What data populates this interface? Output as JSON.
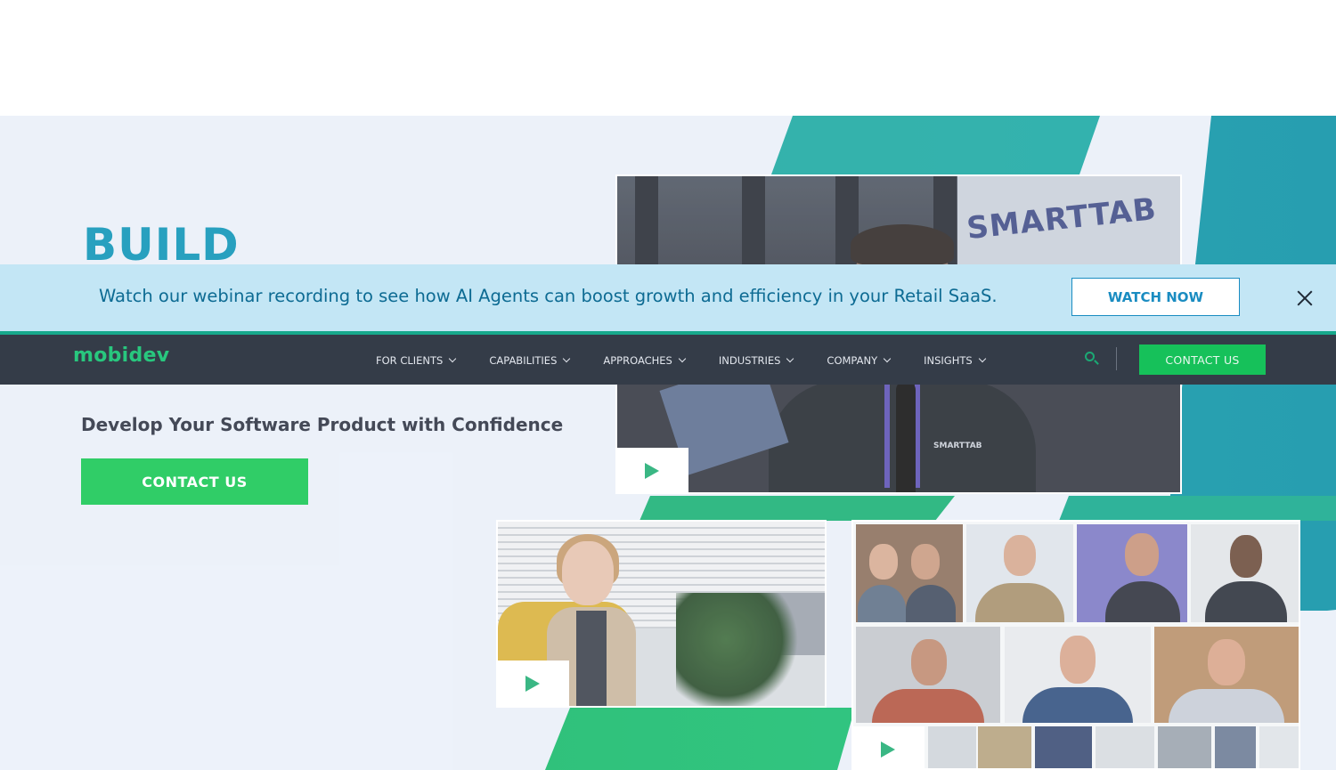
{
  "banner": {
    "text": "Watch our webinar recording to see how AI Agents can boost growth and efficiency in your Retail SaaS.",
    "button": "WATCH NOW"
  },
  "nav": {
    "logo": "mobidev",
    "items": [
      {
        "label": "FOR CLIENTS"
      },
      {
        "label": "CAPABILITIES"
      },
      {
        "label": "APPROACHES"
      },
      {
        "label": "INDUSTRIES"
      },
      {
        "label": "COMPANY"
      },
      {
        "label": "INSIGHTS"
      }
    ],
    "cta": "CONTACT US"
  },
  "hero": {
    "title": "BUILD",
    "subtitle": "Develop Your Software Product with Confidence",
    "cta": "CONTACT US"
  },
  "videos": {
    "main_sign": "SMARTTAB",
    "main_shirt_logo": "SMARTTAB"
  },
  "colors": {
    "accent_green": "#16c15a",
    "brand_teal": "#0b93b7",
    "nav_bg": "#343c48",
    "banner_bg": "#c3e6f5"
  }
}
